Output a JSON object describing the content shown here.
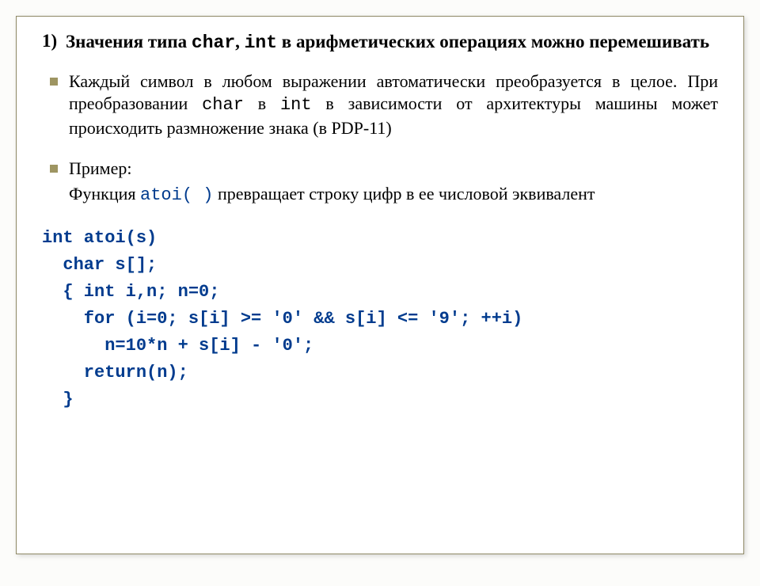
{
  "heading": {
    "number": "1)",
    "prefix": "Значения типа ",
    "code1": "char",
    "mid1": ", ",
    "code2": "int",
    "suffix": " в арифметических операциях можно перемешивать"
  },
  "bullet1": {
    "p1": "Каждый символ в любом выражении автоматически преобразуется в целое. При преобразовании ",
    "c1": "char",
    "p2": " в ",
    "c2": "int",
    "p3": " в зависимости от архитектуры машины может происходить размножение знака (в PDP-11)"
  },
  "bullet2": {
    "label": "Пример:",
    "sub_p1": " Функция ",
    "sub_c1": "atoi( )",
    "sub_p2": " превращает строку цифр в ее числовой эквивалент"
  },
  "code": {
    "l1": "int atoi(s)",
    "l2": "  char s[];",
    "l3": "  { int i,n; n=0;",
    "l4": "    for (i=0; s[i] >= '0' && s[i] <= '9'; ++i)",
    "l5": "      n=10*n + s[i] - '0';",
    "l6": "    return(n);",
    "l7": "  }"
  }
}
